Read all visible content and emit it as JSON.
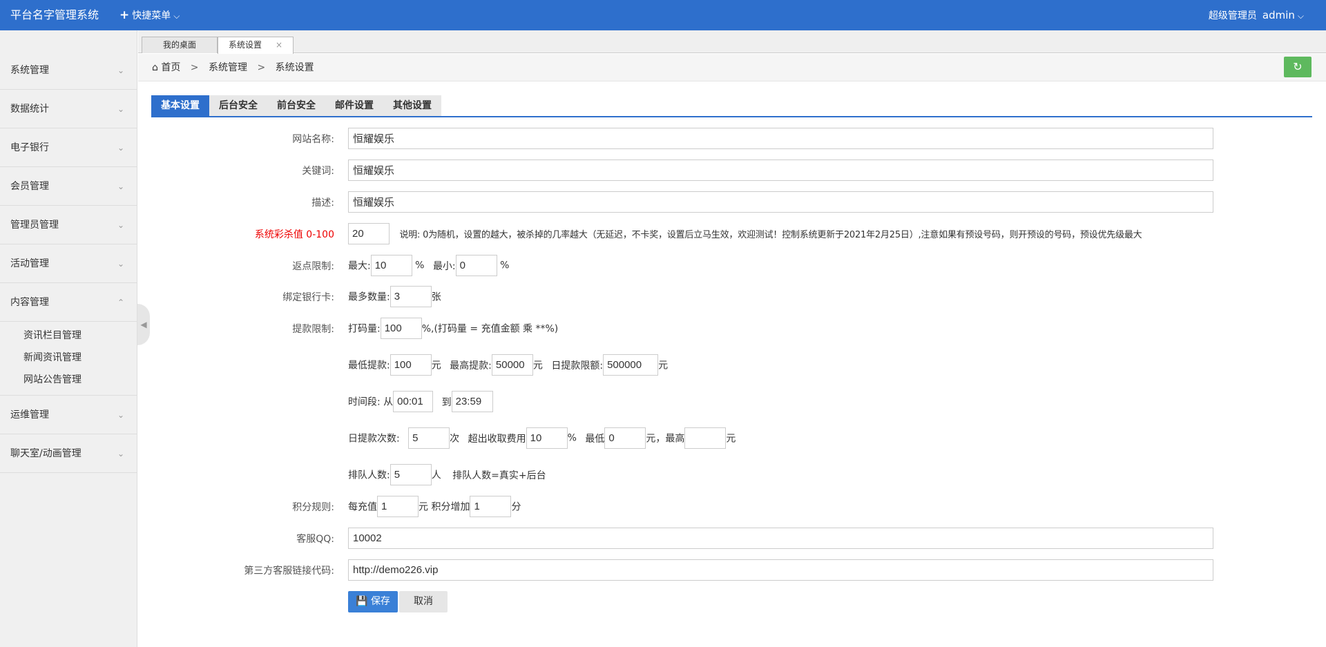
{
  "app": {
    "title": "平台名字管理系统",
    "quick_menu": "快捷菜单",
    "role": "超级管理员",
    "username": "admin"
  },
  "sidebar": {
    "items": [
      {
        "label": "系统管理"
      },
      {
        "label": "数据统计"
      },
      {
        "label": "电子银行"
      },
      {
        "label": "会员管理"
      },
      {
        "label": "管理员管理"
      },
      {
        "label": "活动管理"
      },
      {
        "label": "内容管理"
      },
      {
        "label": "运维管理"
      },
      {
        "label": "聊天室/动画管理"
      }
    ],
    "submenu": [
      {
        "label": "资讯栏目管理"
      },
      {
        "label": "新闻资讯管理"
      },
      {
        "label": "网站公告管理"
      }
    ]
  },
  "tabs": [
    {
      "label": "我的桌面"
    },
    {
      "label": "系统设置"
    }
  ],
  "breadcrumb": {
    "home": "首页",
    "level1": "系统管理",
    "level2": "系统设置",
    "sep": ">"
  },
  "main_tabs": [
    {
      "label": "基本设置"
    },
    {
      "label": "后台安全"
    },
    {
      "label": "前台安全"
    },
    {
      "label": "邮件设置"
    },
    {
      "label": "其他设置"
    }
  ],
  "form": {
    "site_name": {
      "label": "网站名称:",
      "value": "恒耀娱乐"
    },
    "keywords": {
      "label": "关键词:",
      "value": "恒耀娱乐"
    },
    "description": {
      "label": "描述:",
      "value": "恒耀娱乐"
    },
    "kill_rate": {
      "label": "系统彩杀值 0-100",
      "value": "20",
      "note": "说明: 0为随机，设置的越大，被杀掉的几率越大（无延迟，不卡奖，设置后立马生效，欢迎测试！控制系统更新于2021年2月25日）,注意如果有预设号码，则开预设的号码，预设优先级最大"
    },
    "rebate": {
      "label": "返点限制:",
      "max_label": "最大:",
      "max_value": "10",
      "min_label": "最小:",
      "min_value": "0",
      "unit": "%"
    },
    "bank_card": {
      "label": "绑定银行卡:",
      "max_label": "最多数量:",
      "value": "3",
      "unit": "张"
    },
    "withdraw": {
      "label": "提款限制:",
      "bet_label": "打码量:",
      "bet_value": "100",
      "bet_note": "%,(打码量 = 充值金额 乘 **%)",
      "min_label": "最低提款:",
      "min_value": "100",
      "max_label": "最高提款:",
      "max_value": "50000",
      "daily_label": "日提款限额:",
      "daily_value": "500000",
      "yuan": "元",
      "time_label": "时间段:",
      "from_label": "从",
      "from_value": "00:01",
      "to_label": "到",
      "to_value": "23:59",
      "count_label": "日提款次数:",
      "count_value": "5",
      "count_unit": "次",
      "fee_label": "超出收取费用",
      "fee_value": "10",
      "fee_unit": "%",
      "fee_min_label": "最低",
      "fee_min_value": "0",
      "fee_max_label": "元，最高",
      "fee_max_value": "",
      "queue_label": "排队人数:",
      "queue_value": "5",
      "queue_unit": "人",
      "queue_note": "排队人数=真实+后台"
    },
    "points": {
      "label": "积分规则:",
      "per_label": "每充值",
      "per_value": "1",
      "yuan": "元",
      "add_label": "积分增加",
      "add_value": "1",
      "unit": "分"
    },
    "qq": {
      "label": "客服QQ:",
      "value": "10002"
    },
    "third_party": {
      "label": "第三方客服链接代码:",
      "value": "http://demo226.vip"
    },
    "save": "保存",
    "cancel": "取消"
  },
  "colors": {
    "primary": "#2e6fcc",
    "danger": "#e00000",
    "success": "#5eb95e"
  }
}
